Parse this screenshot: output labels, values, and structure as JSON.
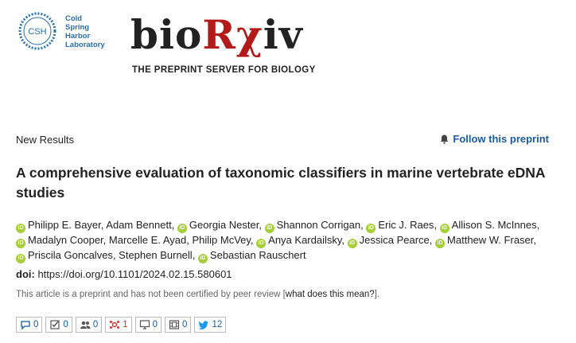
{
  "header": {
    "csh_mark": "CSH",
    "csh_lines": [
      "Cold",
      "Spring",
      "Harbor",
      "Laboratory"
    ],
    "logo_black": "bio",
    "logo_red": "Rχ",
    "logo_black2": "iv",
    "tagline": "THE PREPRINT SERVER FOR BIOLOGY"
  },
  "article": {
    "section": "New Results",
    "follow_label": "Follow this preprint",
    "title": "A comprehensive evaluation of taxonomic classifiers in marine vertebrate eDNA studies",
    "authors": [
      {
        "name": "Philipp E. Bayer",
        "orcid": true
      },
      {
        "name": "Adam Bennett",
        "orcid": false
      },
      {
        "name": "Georgia Nester",
        "orcid": true
      },
      {
        "name": "Shannon Corrigan",
        "orcid": true
      },
      {
        "name": "Eric J. Raes",
        "orcid": true
      },
      {
        "name": "Allison S. McInnes",
        "orcid": true
      },
      {
        "name": "Madalyn Cooper",
        "orcid": true
      },
      {
        "name": "Marcelle E. Ayad",
        "orcid": false
      },
      {
        "name": "Philip McVey",
        "orcid": false
      },
      {
        "name": "Anya Kardailsky",
        "orcid": true
      },
      {
        "name": "Jessica Pearce",
        "orcid": true
      },
      {
        "name": "Matthew W. Fraser",
        "orcid": true
      },
      {
        "name": "Priscila Goncalves",
        "orcid": true
      },
      {
        "name": "Stephen Burnell",
        "orcid": false
      },
      {
        "name": "Sebastian Rauschert",
        "orcid": true
      }
    ],
    "orcid_badge": "iD",
    "doi_label": "doi:",
    "doi_url": "https://doi.org/10.1101/2024.02.15.580601",
    "notice_prefix": "This article is a preprint and has not been certified by peer review [",
    "notice_link": "what does this mean?",
    "notice_suffix": "]."
  },
  "metrics": [
    {
      "icon": "comment-icon",
      "value": "0",
      "color": "#1a5a9e"
    },
    {
      "icon": "checkbox-icon",
      "value": "0",
      "color": "#555555"
    },
    {
      "icon": "users-icon",
      "value": "0",
      "color": "#555555"
    },
    {
      "icon": "altmetric-icon",
      "value": "1",
      "color": "#d9322c"
    },
    {
      "icon": "monitor-icon",
      "value": "0",
      "color": "#555555"
    },
    {
      "icon": "film-icon",
      "value": "0",
      "color": "#555555"
    },
    {
      "icon": "twitter-icon",
      "value": "12",
      "color": "#1d9bf0"
    }
  ]
}
